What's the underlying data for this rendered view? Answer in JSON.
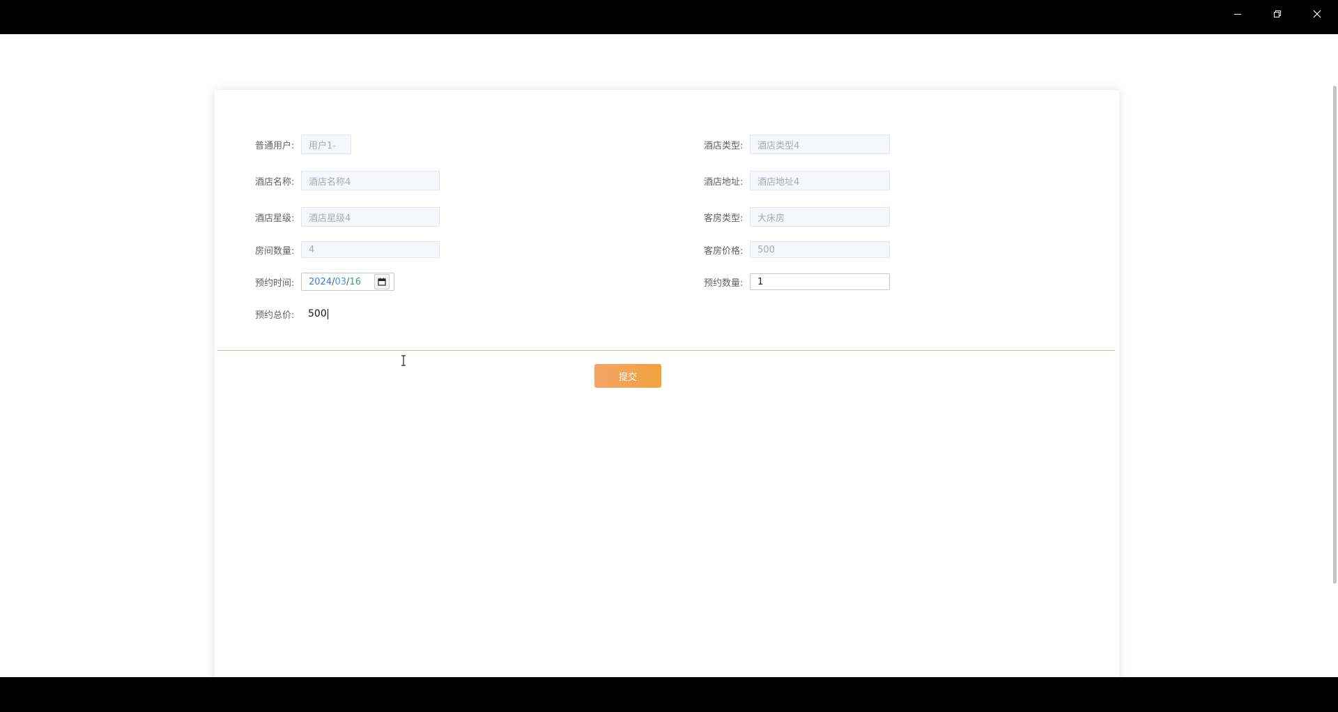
{
  "window": {
    "minimize_icon": "minimize-icon",
    "restore_icon": "restore-icon",
    "close_icon": "close-icon"
  },
  "form": {
    "left": [
      {
        "label": "普通用户:",
        "value": "用户1-",
        "state": "readonly"
      },
      {
        "label": "酒店名称:",
        "value": "酒店名称4",
        "state": "readonly"
      },
      {
        "label": "酒店星级:",
        "value": "酒店星级4",
        "state": "readonly"
      },
      {
        "label": "房间数量:",
        "value": "4",
        "state": "readonly"
      }
    ],
    "right": [
      {
        "label": "酒店类型:",
        "value": "酒店类型4",
        "state": "readonly"
      },
      {
        "label": "酒店地址:",
        "value": "酒店地址4",
        "state": "readonly"
      },
      {
        "label": "客房类型:",
        "value": "大床房",
        "state": "readonly"
      },
      {
        "label": "客房价格:",
        "value": "500",
        "state": "readonly"
      }
    ],
    "booking_date": {
      "label": "预约时间:",
      "year": "2024",
      "month": "03",
      "day": "16",
      "separator": "/",
      "icon": "calendar-icon"
    },
    "booking_count": {
      "label": "预约数量:",
      "value": "1"
    },
    "booking_total": {
      "label": "预约总价:",
      "value": "500"
    },
    "submit_label": "提交"
  },
  "colors": {
    "accent_start": "#f3a468",
    "accent_end": "#f0a33c",
    "divider": "#e9b88a",
    "date_year": "#3a7bd5",
    "date_day": "#3ca55c"
  }
}
